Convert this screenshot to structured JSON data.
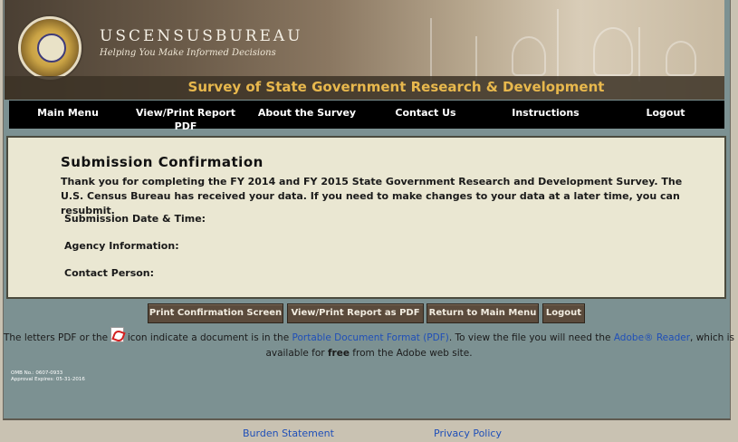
{
  "header": {
    "agency_name": "USCENSUSBUREAU",
    "tagline": "Helping You Make Informed Decisions",
    "survey_title": "Survey of State Government Research & Development"
  },
  "nav": {
    "items": [
      {
        "label": "Main Menu"
      },
      {
        "label": "View/Print Report PDF"
      },
      {
        "label": "About the Survey"
      },
      {
        "label": "Contact Us"
      },
      {
        "label": "Instructions"
      },
      {
        "label": "Logout"
      }
    ]
  },
  "confirmation": {
    "title": "Submission Confirmation",
    "message": "Thank you for completing the FY 2014 and FY 2015 State Government Research and Development Survey. The U.S. Census Bureau has received your data. If you need to make changes to your data at a later time, you can resubmit.",
    "fields": [
      {
        "label": "Submission Date & Time:"
      },
      {
        "label": "Agency Information:"
      },
      {
        "label": "Contact Person:"
      }
    ]
  },
  "buttons": {
    "print_confirmation": "Print Confirmation Screen",
    "view_print_pdf": "View/Print Report as PDF",
    "return_main": "Return to Main Menu",
    "logout": "Logout"
  },
  "pdf_note": {
    "part1": "The letters PDF or the",
    "part2": "icon indicate a document is in the",
    "link_pdf": "Portable Document Format (PDF)",
    "part3": ". To view the file you will need the",
    "link_reader": "Adobe® Reader",
    "part4": ", which is available for",
    "free": "free",
    "part5": "from the Adobe web site."
  },
  "omb": {
    "line1": "OMB No.: 0607-0933",
    "line2": "Approval Expires: 05-31-2016"
  },
  "footer": {
    "burden": "Burden Statement",
    "privacy": "Privacy Policy"
  },
  "colors": {
    "nav_bg": "#000000",
    "title_gold": "#e8b84d",
    "content_bg": "#eae7d2",
    "button_bg": "#5b4b3c",
    "link": "#1f4fb8"
  }
}
